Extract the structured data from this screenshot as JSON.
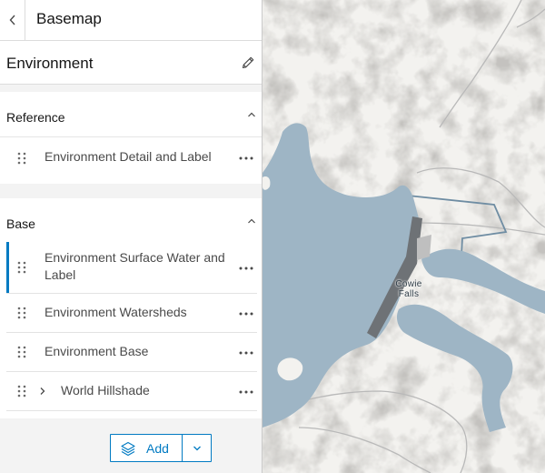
{
  "header": {
    "title": "Basemap"
  },
  "basemap": {
    "name": "Environment"
  },
  "reference": {
    "label": "Reference",
    "layers": [
      {
        "label": "Environment Detail and Label"
      }
    ]
  },
  "base": {
    "label": "Base",
    "layers": [
      {
        "label": "Environment Surface Water and Label",
        "active": true
      },
      {
        "label": "Environment Watersheds"
      },
      {
        "label": "Environment Base"
      },
      {
        "label": "World Hillshade",
        "expandable": true
      }
    ]
  },
  "footer": {
    "add_label": "Add"
  },
  "map": {
    "place_label_line1": "Cowie",
    "place_label_line2": "Falls"
  },
  "colors": {
    "accent": "#007ac2",
    "water": "#9eb5c5",
    "dam": "#6e7276"
  },
  "icons": {
    "back": "chevron-left-icon",
    "edit": "pencil-icon",
    "collapse": "chevron-up-icon",
    "grip": "drag-handle-icon",
    "more": "ellipsis-icon",
    "expand": "chevron-right-icon",
    "add": "layers-icon",
    "dropdown": "chevron-down-icon"
  }
}
